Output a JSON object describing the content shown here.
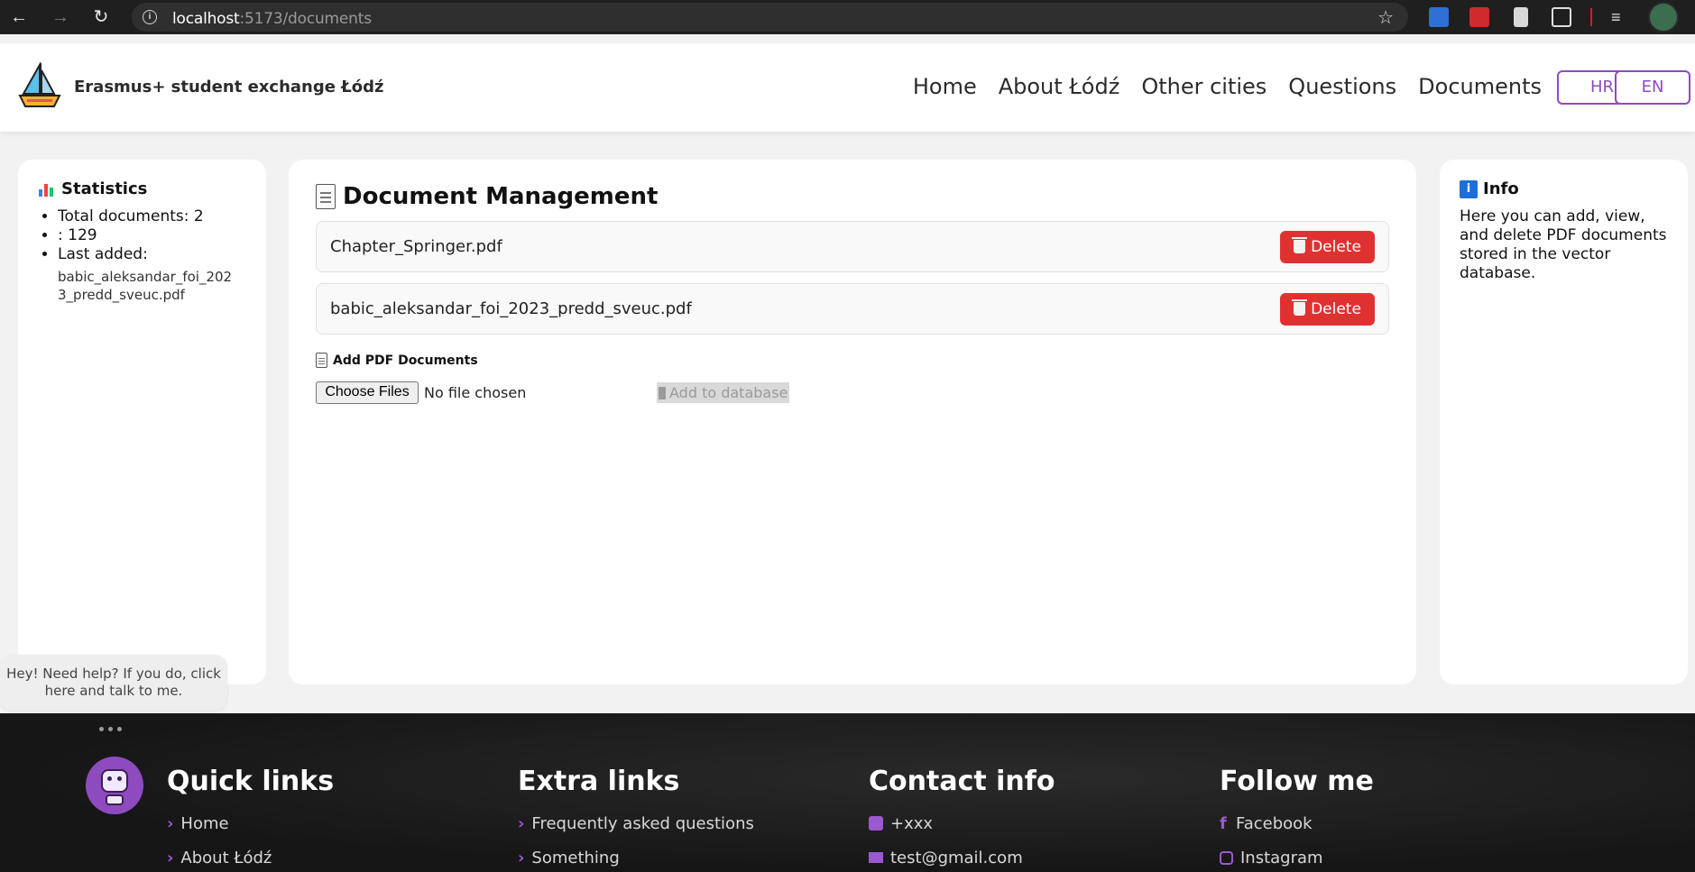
{
  "browser": {
    "url_host": "localhost",
    "url_path": ":5173/documents"
  },
  "header": {
    "brand": "Erasmus+ student exchange Łódź",
    "nav": [
      "Home",
      "About Łódź",
      "Other cities",
      "Questions",
      "Documents"
    ],
    "lang_hr": "HR",
    "lang_en": "EN"
  },
  "stats": {
    "title": "Statistics",
    "total_documents": "Total documents: 2",
    "chunks": ": 129",
    "last_added_label": "Last added:",
    "last_added_file": "babic_aleksandar_foi_2023_predd_sveuc.pdf"
  },
  "main": {
    "title": "Document Management",
    "documents": [
      {
        "name": "Chapter_Springer.pdf",
        "delete_label": "Delete"
      },
      {
        "name": "babic_aleksandar_foi_2023_predd_sveuc.pdf",
        "delete_label": "Delete"
      }
    ],
    "add_title": "Add PDF Documents",
    "choose_files": "Choose Files",
    "no_file": "No file chosen",
    "add_to_db": "Add to database"
  },
  "info": {
    "title": "Info",
    "text": "Here you can add, view, and delete PDF documents stored in the vector database."
  },
  "chat": {
    "bubble": "Hey! Need help? If you do, click here and talk to me."
  },
  "footer": {
    "quick_links": {
      "title": "Quick links",
      "items": [
        "Home",
        "About Łódź"
      ]
    },
    "extra_links": {
      "title": "Extra links",
      "items": [
        "Frequently asked questions",
        "Something"
      ]
    },
    "contact": {
      "title": "Contact info",
      "phone": "+xxx",
      "email": "test@gmail.com"
    },
    "follow": {
      "title": "Follow me",
      "facebook": "Facebook",
      "instagram": "Instagram"
    }
  },
  "colors": {
    "accent": "#8e4bc0",
    "delete": "#e03131",
    "footer_bg": "#1b1b1b"
  }
}
